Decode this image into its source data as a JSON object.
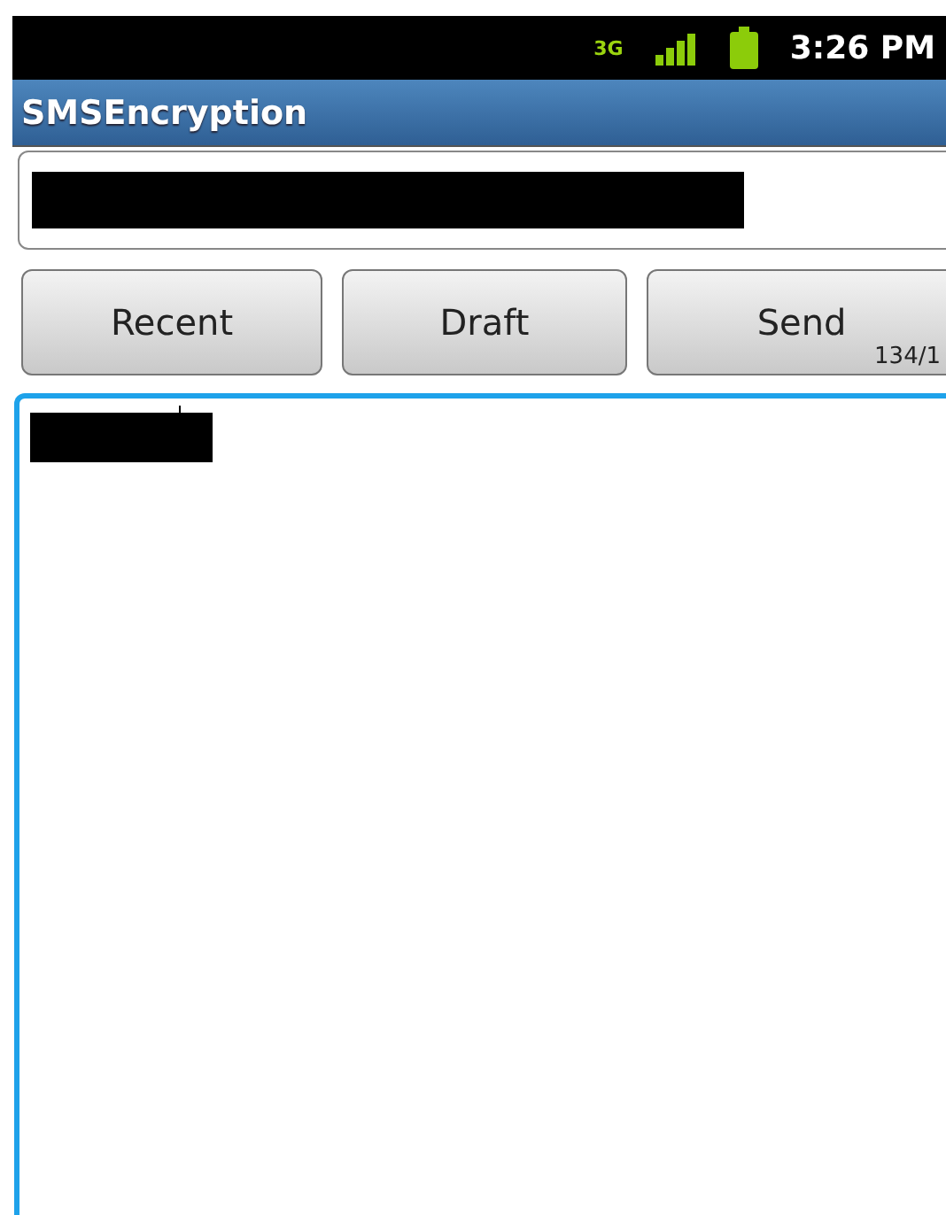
{
  "status_bar": {
    "network": "3G",
    "time": "3:26 PM"
  },
  "title_bar": {
    "title": "SMSEncryption"
  },
  "recipient_field": {
    "redacted": true
  },
  "buttons": [
    {
      "label": "Recent"
    },
    {
      "label": "Draft"
    },
    {
      "label": "Send",
      "counter": "134/1"
    }
  ],
  "message_field": {
    "focused": true,
    "redacted": true
  }
}
